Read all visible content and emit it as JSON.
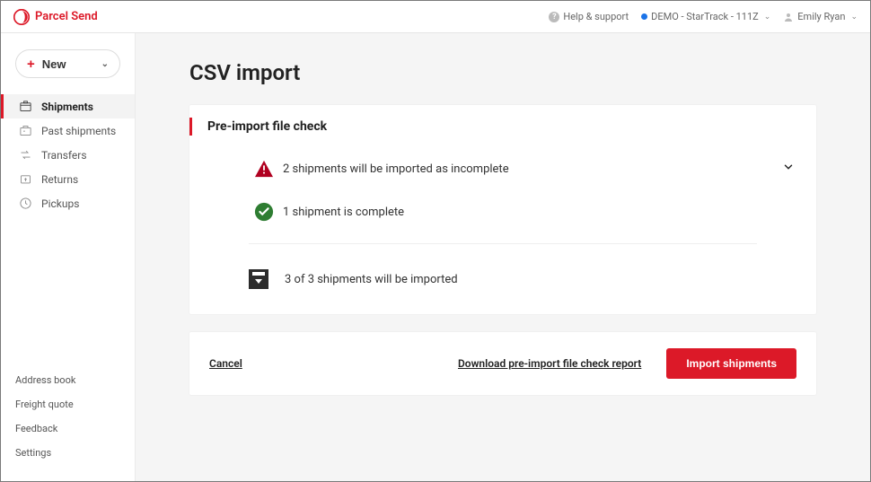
{
  "brand": {
    "name": "Parcel Send"
  },
  "header": {
    "help_label": "Help & support",
    "account_label": "DEMO - StarTrack - 111Z",
    "user_name": "Emily Ryan"
  },
  "sidebar": {
    "new_label": "New",
    "nav": [
      {
        "label": "Shipments",
        "active": true
      },
      {
        "label": "Past shipments",
        "active": false
      },
      {
        "label": "Transfers",
        "active": false
      },
      {
        "label": "Returns",
        "active": false
      },
      {
        "label": "Pickups",
        "active": false
      }
    ],
    "bottom_links": [
      {
        "label": "Address book"
      },
      {
        "label": "Freight quote"
      },
      {
        "label": "Feedback"
      },
      {
        "label": "Settings"
      }
    ]
  },
  "page": {
    "title": "CSV import",
    "card_title": "Pre-import file check",
    "status": {
      "incomplete": "2 shipments will be imported as incomplete",
      "complete": "1 shipment is complete"
    },
    "summary": "3 of 3 shipments will be imported",
    "actions": {
      "cancel": "Cancel",
      "download": "Download pre-import file check report",
      "import": "Import shipments"
    }
  }
}
